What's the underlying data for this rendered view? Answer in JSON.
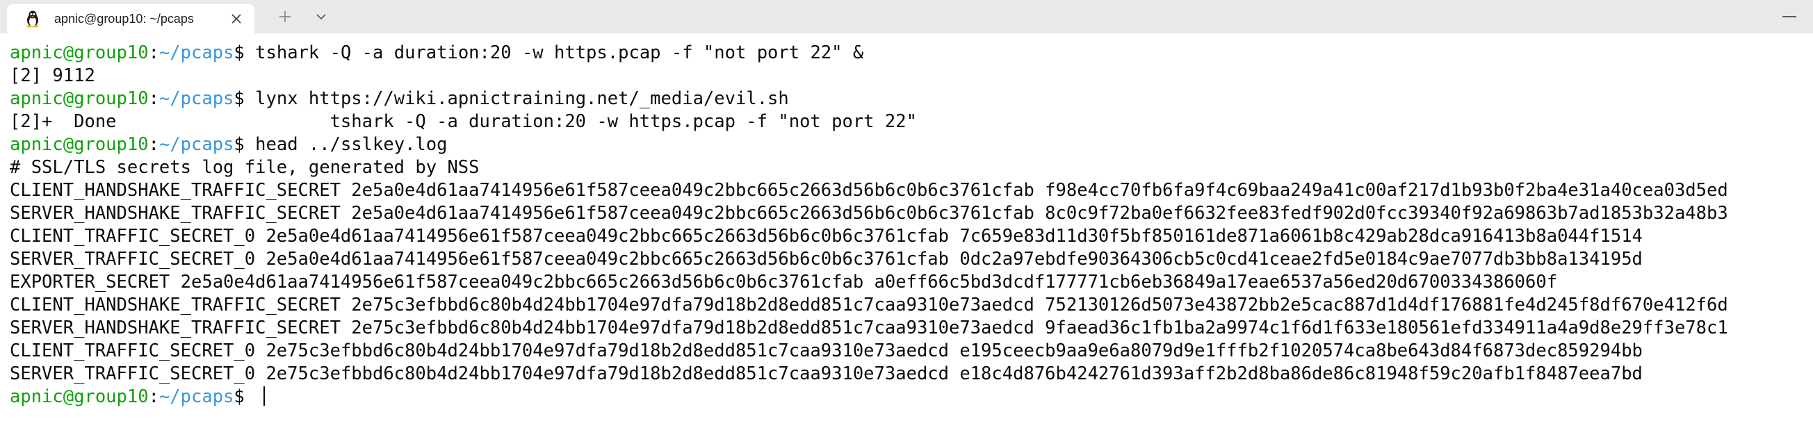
{
  "tab": {
    "title": "apnic@group10: ~/pcaps",
    "icon": "linux-penguin-icon"
  },
  "prompt": {
    "user": "apnic@group10",
    "sep": ":",
    "path": "~/pcaps",
    "dollar": "$ "
  },
  "colors": {
    "prompt_user": "#13a10e",
    "prompt_path": "#3a96dd",
    "text": "#0c0c0c",
    "tabbar": "#e9e9e9"
  },
  "lines": [
    {
      "prompt": true,
      "text": "tshark -Q -a duration:20 -w https.pcap -f \"not port 22\" &"
    },
    {
      "prompt": false,
      "text": "[2] 9112"
    },
    {
      "prompt": true,
      "text": "lynx https://wiki.apnictraining.net/_media/evil.sh"
    },
    {
      "prompt": false,
      "text": "[2]+  Done                    tshark -Q -a duration:20 -w https.pcap -f \"not port 22\""
    },
    {
      "prompt": true,
      "text": "head ../sslkey.log"
    },
    {
      "prompt": false,
      "text": "# SSL/TLS secrets log file, generated by NSS"
    },
    {
      "prompt": false,
      "text": "CLIENT_HANDSHAKE_TRAFFIC_SECRET 2e5a0e4d61aa7414956e61f587ceea049c2bbc665c2663d56b6c0b6c3761cfab f98e4cc70fb6fa9f4c69baa249a41c00af217d1b93b0f2ba4e31a40cea03d5ed"
    },
    {
      "prompt": false,
      "text": "SERVER_HANDSHAKE_TRAFFIC_SECRET 2e5a0e4d61aa7414956e61f587ceea049c2bbc665c2663d56b6c0b6c3761cfab 8c0c9f72ba0ef6632fee83fedf902d0fcc39340f92a69863b7ad1853b32a48b3"
    },
    {
      "prompt": false,
      "text": "CLIENT_TRAFFIC_SECRET_0 2e5a0e4d61aa7414956e61f587ceea049c2bbc665c2663d56b6c0b6c3761cfab 7c659e83d11d30f5bf850161de871a6061b8c429ab28dca916413b8a044f1514"
    },
    {
      "prompt": false,
      "text": "SERVER_TRAFFIC_SECRET_0 2e5a0e4d61aa7414956e61f587ceea049c2bbc665c2663d56b6c0b6c3761cfab 0dc2a97ebdfe90364306cb5c0cd41ceae2fd5e0184c9ae7077db3bb8a134195d"
    },
    {
      "prompt": false,
      "text": "EXPORTER_SECRET 2e5a0e4d61aa7414956e61f587ceea049c2bbc665c2663d56b6c0b6c3761cfab a0eff66c5bd3dcdf177771cb6eb36849a17eae6537a56ed20d6700334386060f"
    },
    {
      "prompt": false,
      "text": "CLIENT_HANDSHAKE_TRAFFIC_SECRET 2e75c3efbbd6c80b4d24bb1704e97dfa79d18b2d8edd851c7caa9310e73aedcd 752130126d5073e43872bb2e5cac887d1d4df176881fe4d245f8df670e412f6d"
    },
    {
      "prompt": false,
      "text": "SERVER_HANDSHAKE_TRAFFIC_SECRET 2e75c3efbbd6c80b4d24bb1704e97dfa79d18b2d8edd851c7caa9310e73aedcd 9faead36c1fb1ba2a9974c1f6d1f633e180561efd334911a4a9d8e29ff3e78c1"
    },
    {
      "prompt": false,
      "text": "CLIENT_TRAFFIC_SECRET_0 2e75c3efbbd6c80b4d24bb1704e97dfa79d18b2d8edd851c7caa9310e73aedcd e195ceecb9aa9e6a8079d9e1fffb2f1020574ca8be643d84f6873dec859294bb"
    },
    {
      "prompt": false,
      "text": "SERVER_TRAFFIC_SECRET_0 2e75c3efbbd6c80b4d24bb1704e97dfa79d18b2d8edd851c7caa9310e73aedcd e18c4d876b4242761d393aff2b2d8ba86de86c81948f59c20afb1f8487eea7bd"
    },
    {
      "prompt": true,
      "text": ""
    }
  ]
}
